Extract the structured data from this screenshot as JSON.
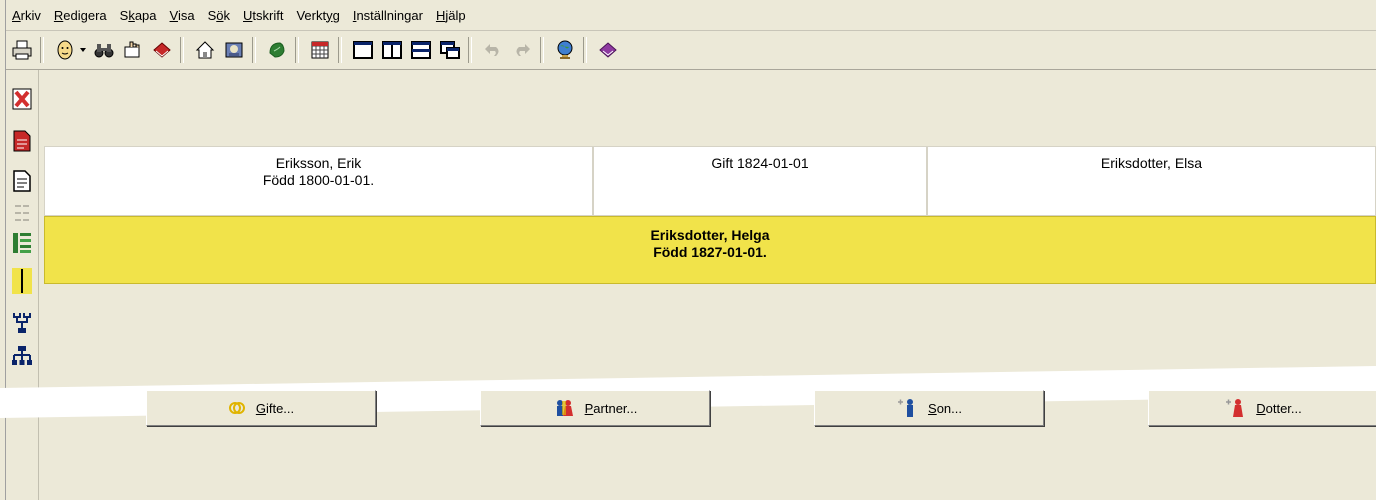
{
  "menu": [
    {
      "ul": "A",
      "rest": "rkiv"
    },
    {
      "ul": "R",
      "rest": "edigera"
    },
    {
      "pre": "S",
      "ul": "k",
      "rest": "apa"
    },
    {
      "ul": "V",
      "rest": "isa"
    },
    {
      "pre": "S",
      "ul": "ö",
      "rest": "k"
    },
    {
      "ul": "U",
      "rest": "tskrift"
    },
    {
      "pre": "Verkt",
      "ul": "y",
      "rest": "g"
    },
    {
      "ul": "I",
      "rest": "nställningar"
    },
    {
      "ul": "H",
      "rest": "jälp"
    }
  ],
  "toolbar_icons": [
    "print-icon",
    "person-icon",
    "dropdown-arrow-icon",
    "binoculars-icon",
    "hand-icon",
    "book-icon",
    "home-icon",
    "image-icon",
    "leaf-icon",
    "calendar-icon",
    "view-single-icon",
    "view-split-icon",
    "view-horizontal-icon",
    "view-cascade-icon",
    "undo-icon",
    "redo-icon",
    "globe-icon",
    "help-book-icon"
  ],
  "family": {
    "husband": {
      "name": "Eriksson, Erik",
      "born": "Född 1800-01-01."
    },
    "marriage": {
      "text": "Gift 1824-01-01"
    },
    "wife": {
      "name": "Eriksdotter, Elsa"
    },
    "child": {
      "name": "Eriksdotter, Helga",
      "born": "Född 1827-01-01."
    }
  },
  "buttons": {
    "marriage": {
      "ul": "G",
      "rest": "ifte..."
    },
    "partner": {
      "ul": "P",
      "rest": "artner..."
    },
    "son": {
      "ul": "S",
      "rest": "on..."
    },
    "daughter": {
      "ul": "D",
      "rest": "otter..."
    }
  },
  "colors": {
    "child_highlight": "#f1e34a",
    "window_bg": "#ece9d8"
  }
}
